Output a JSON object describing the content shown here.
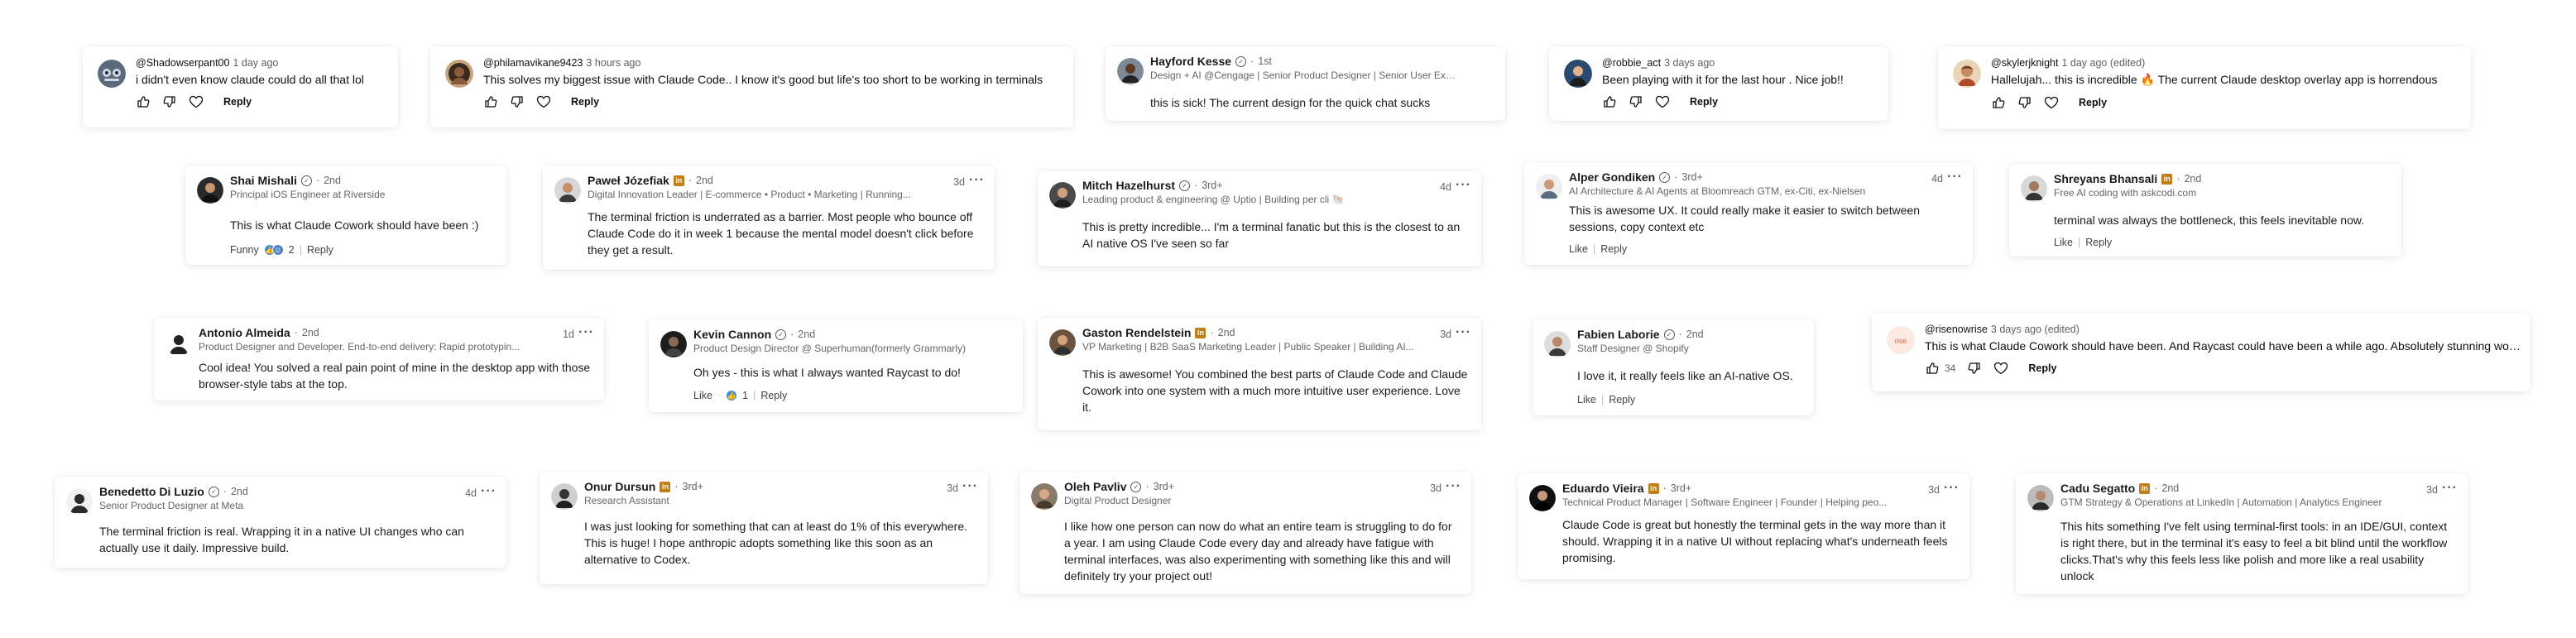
{
  "colors": {
    "li_blue": "#378fe9",
    "li_green": "#44712e",
    "yt_text": "#0f0f0f",
    "li_badge": "#c37d16"
  },
  "youtube": [
    {
      "handle": "@Shadowserpant00",
      "time": "1 day ago",
      "text": "i didn't even know claude could do all that lol",
      "likes": "",
      "reply": "Reply"
    },
    {
      "handle": "@philamavikane9423",
      "time": "3 hours ago",
      "text": "This solves my biggest issue with Claude Code.. I know it's good but life's too short to be working in terminals",
      "likes": "",
      "reply": "Reply"
    },
    {
      "handle": "@robbie_act",
      "time": "3 days ago",
      "text": "Been playing with it for the last hour . Nice job!!",
      "likes": "",
      "reply": "Reply"
    },
    {
      "handle": "@skylerjknight",
      "time": "1 day ago (edited)",
      "text": "Hallelujah... this is incredible 🔥 The current Claude desktop overlay app is horrendous",
      "likes": "",
      "reply": "Reply"
    },
    {
      "handle": "@risenowrise",
      "time": "3 days ago (edited)",
      "text": "This is what Claude Cowork should have been. And Raycast could have been a while ago. Absolutely stunning work.",
      "likes": "34",
      "reply": "Reply"
    }
  ],
  "linkedin": [
    {
      "name": "Hayford Kesse",
      "deg": "1st",
      "headline": "Design + AI @Cengage | Senior Product Designer | Senior User Experien...",
      "time": "",
      "text": "this is sick! The current design for the quick chat sucks"
    },
    {
      "name": "Shai Mishali",
      "deg": "2nd",
      "headline": "Principal iOS Engineer at Riverside",
      "time": "",
      "text": "This is what Claude Cowork should have been :)",
      "react": "Funny",
      "count": "2",
      "reply": "Reply"
    },
    {
      "name": "Paweł Józefiak",
      "deg": "2nd",
      "headline": "Digital Innovation Leader | E-commerce • Product • Marketing | Running...",
      "time": "3d",
      "text": "The terminal friction is underrated as a barrier. Most people who bounce off Claude Code do it in week 1 because the mental model doesn't click before they get a result."
    },
    {
      "name": "Mitch Hazelhurst",
      "deg": "3rd+",
      "headline": "Leading product & engineering @ Uptio | Building per cli 🐚",
      "time": "4d",
      "text": "This is pretty incredible... I'm a terminal fanatic but this is the closest to an AI native OS I've seen so far"
    },
    {
      "name": "Alper Gondiken",
      "deg": "3rd+",
      "headline": "AI Architecture & AI Agents at Bloomreach GTM, ex-Citi, ex-Nielsen",
      "time": "4d",
      "text": "This is awesome UX. It could really make it easier to switch between sessions, copy context etc",
      "like": "Like",
      "reply": "Reply"
    },
    {
      "name": "Shreyans Bhansali",
      "deg": "2nd",
      "headline": "Free AI coding with askcodi.com",
      "time": "",
      "text": "terminal was always the bottleneck, this feels inevitable now.",
      "like": "Like",
      "reply": "Reply"
    },
    {
      "name": "Antonio Almeida",
      "deg": "2nd",
      "headline": "Product Designer and Developer. End-to-end delivery: Rapid prototypin...",
      "time": "1d",
      "text": "Cool idea! You solved a real pain point of mine in the desktop app with those browser-style tabs at the top."
    },
    {
      "name": "Kevin Cannon",
      "deg": "2nd",
      "headline": "Product Design Director @ Superhuman(formerly Grammarly)",
      "time": "",
      "text": "Oh yes - this is what I always wanted Raycast to do!",
      "like": "Like",
      "count": "1",
      "reply": "Reply"
    },
    {
      "name": "Gaston Rendelstein",
      "deg": "2nd",
      "headline": "VP Marketing | B2B SaaS Marketing Leader | Public Speaker | Building AI...",
      "time": "3d",
      "text": "This is awesome! You combined the best parts of Claude Code and Claude Cowork into one system with a much more intuitive user experience. Love it."
    },
    {
      "name": "Fabien Laborie",
      "deg": "2nd",
      "headline": "Staff Designer @ Shopify",
      "time": "",
      "text": "I love it, it really feels like an AI-native OS.",
      "like": "Like",
      "reply": "Reply"
    },
    {
      "name": "Benedetto Di Luzio",
      "deg": "2nd",
      "headline": "Senior Product Designer at Meta",
      "time": "4d",
      "text": "The terminal friction is real. Wrapping it in a native UI changes who can actually use it daily. Impressive build."
    },
    {
      "name": "Onur Dursun",
      "deg": "3rd+",
      "headline": "Research Assistant",
      "time": "3d",
      "text": "I was just looking for something that can at least do 1% of this everywhere. This is huge! I hope anthropic adopts something like this soon as an alternative to Codex."
    },
    {
      "name": "Oleh Pavliv",
      "deg": "3rd+",
      "headline": "Digital Product Designer",
      "time": "3d",
      "text": "I like how one person can now do what an entire team is struggling to do for a year. I am using Claude Code every day and already have fatigue with terminal interfaces, was also experimenting with something like this and will definitely try your project out!"
    },
    {
      "name": "Eduardo Vieira",
      "deg": "3rd+",
      "headline": "Technical Product Manager | Software Engineer | Founder | Helping peo...",
      "time": "3d",
      "text": "Claude Code is great but honestly the terminal gets in the way more than it should. Wrapping it in a native UI without replacing what's underneath feels promising."
    },
    {
      "name": "Cadu Segatto",
      "deg": "2nd",
      "headline": "GTM Strategy & Operations at LinkedIn | Automation | Analytics Engineer",
      "time": "3d",
      "text": "This hits something I've felt using terminal-first tools: in an IDE/GUI, context is right there, but in the terminal it's easy to feel a bit blind until the workflow clicks.That's why this feels less like polish and more like a real usability unlock"
    }
  ]
}
